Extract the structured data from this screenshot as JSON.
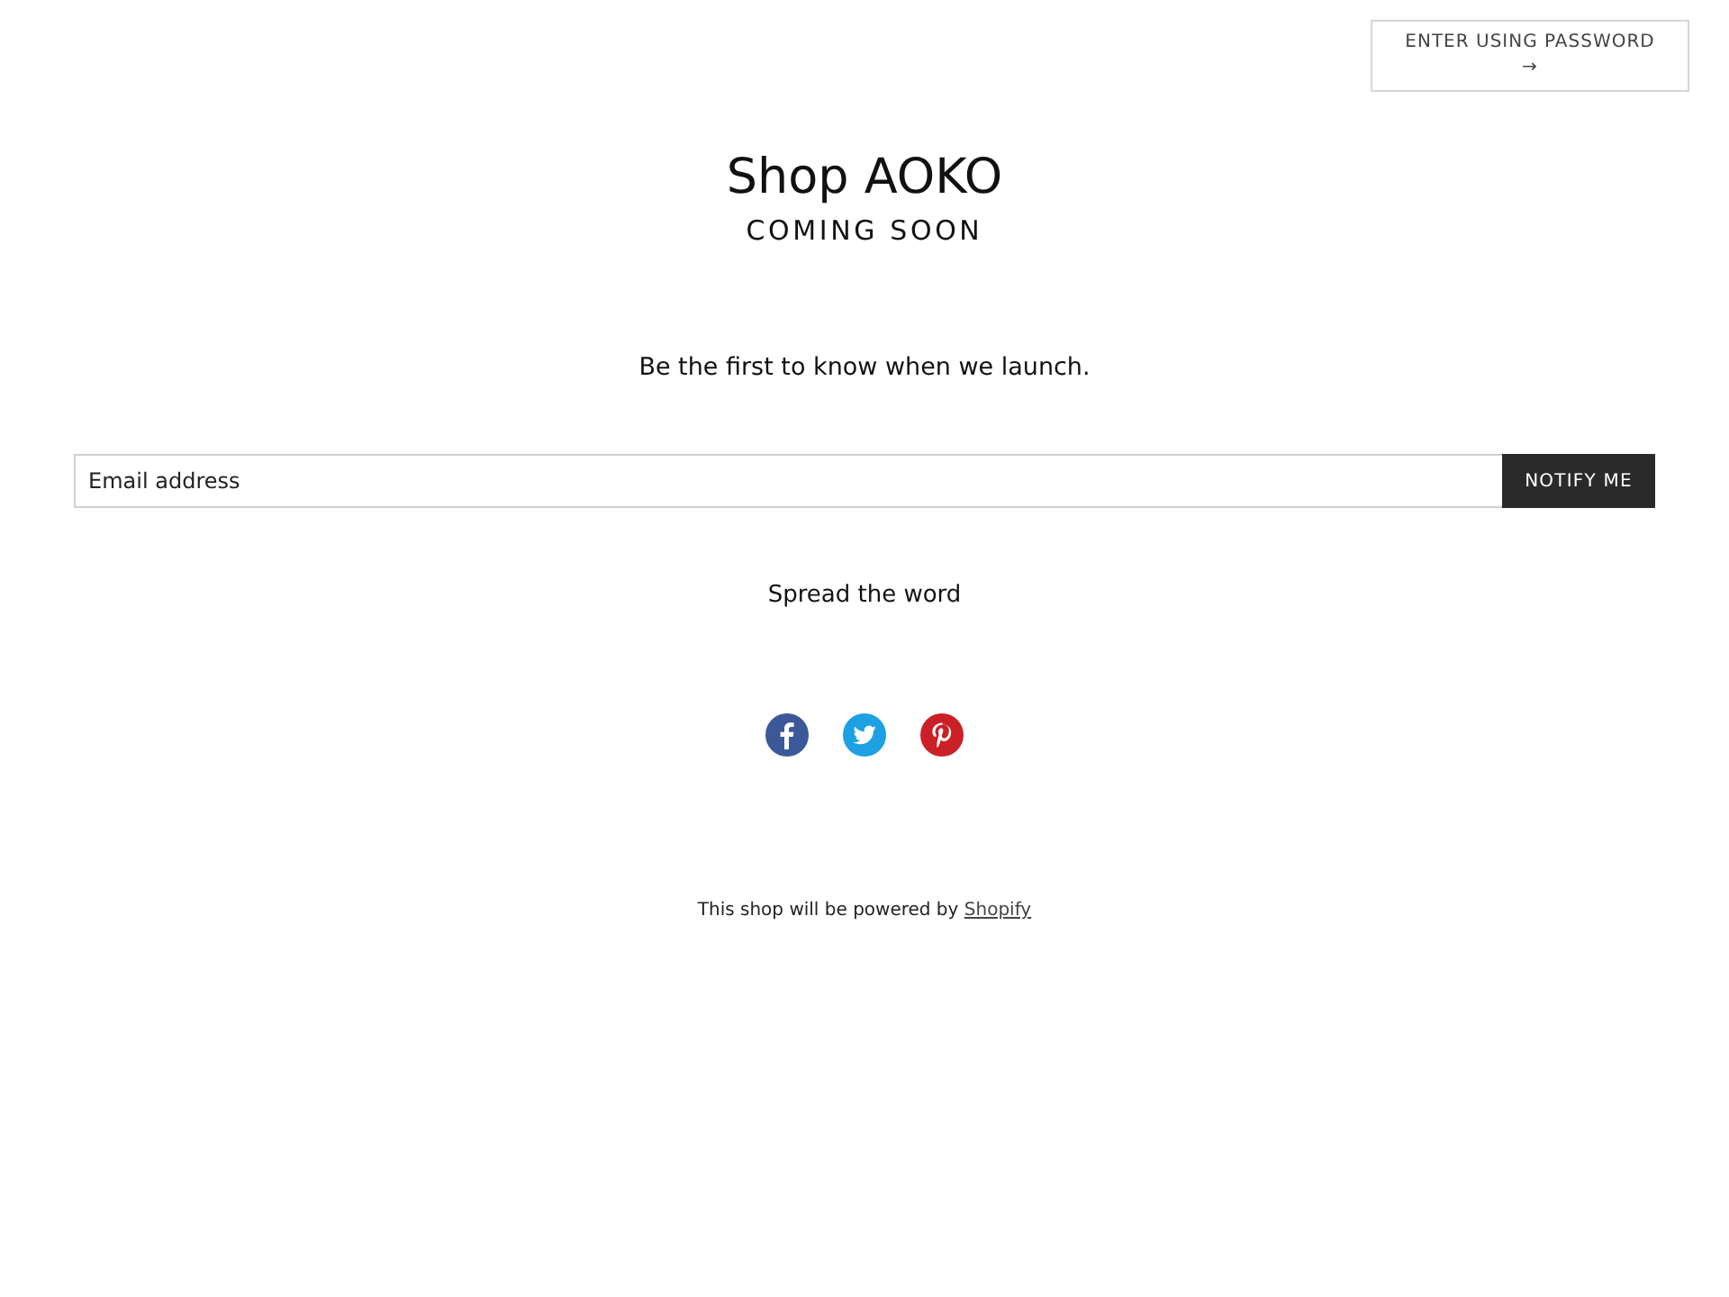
{
  "password_button": {
    "label": "ENTER USING PASSWORD",
    "arrow": "→"
  },
  "title": "Shop AOKO",
  "subtitle": "COMING SOON",
  "tagline": "Be the first to know when we launch.",
  "signup": {
    "placeholder": "Email address",
    "button": "NOTIFY ME"
  },
  "share_heading": "Spread the word",
  "share_links": [
    {
      "kind": "facebook",
      "color": "#3b5998"
    },
    {
      "kind": "twitter",
      "color": "#1da1e2"
    },
    {
      "kind": "pinterest",
      "color": "#cb2027"
    }
  ],
  "footer": {
    "text": "This shop will be powered by",
    "link": "Shopify"
  }
}
